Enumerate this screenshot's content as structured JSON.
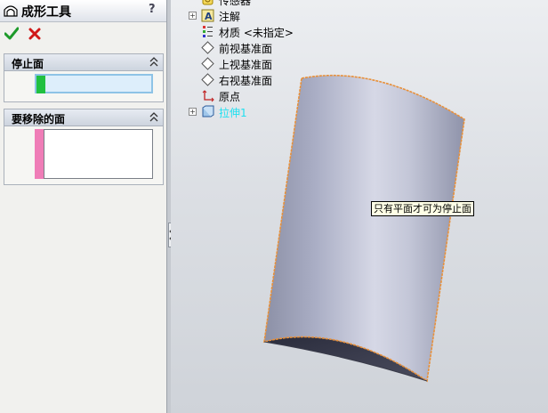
{
  "panel": {
    "title": "成形工具",
    "help": "?",
    "groups": [
      {
        "title": "停止面"
      },
      {
        "title": "要移除的面"
      }
    ]
  },
  "tree": {
    "items": [
      {
        "label": "传感器",
        "icon": "sensor-icon",
        "expandable": false
      },
      {
        "label": "注解",
        "icon": "annotation-icon",
        "expandable": true
      },
      {
        "label": "材质 <未指定>",
        "icon": "material-icon",
        "expandable": false
      },
      {
        "label": "前视基准面",
        "icon": "plane-icon",
        "expandable": false
      },
      {
        "label": "上视基准面",
        "icon": "plane-icon",
        "expandable": false
      },
      {
        "label": "右视基准面",
        "icon": "plane-icon",
        "expandable": false
      },
      {
        "label": "原点",
        "icon": "origin-icon",
        "expandable": false
      },
      {
        "label": "拉伸1",
        "icon": "extrude-icon",
        "expandable": true,
        "highlighted": true
      }
    ]
  },
  "tooltip": {
    "text": "只有平面才可为停止面"
  },
  "colors": {
    "stop_face_marker": "#20c040",
    "remove_face_marker": "#ef7db7",
    "edge_highlight": "#e8903a",
    "tree_highlight": "#1fe0f0"
  }
}
